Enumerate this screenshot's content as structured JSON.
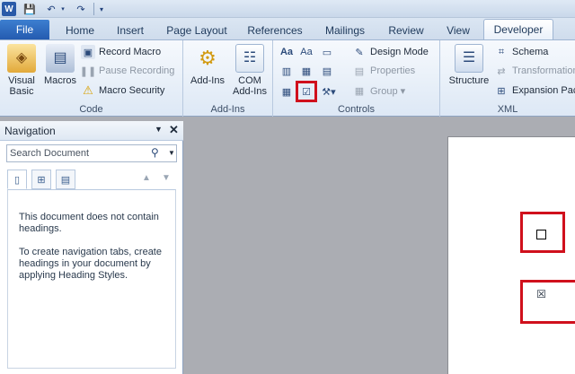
{
  "quick_access": {
    "app_badge": "W",
    "save": "💾",
    "undo": "↶",
    "redo": "↷",
    "dropdown": "▾"
  },
  "tabs": [
    "File",
    "Home",
    "Insert",
    "Page Layout",
    "References",
    "Mailings",
    "Review",
    "View",
    "Developer"
  ],
  "ribbon": {
    "code": {
      "label": "Code",
      "visual_basic": [
        "Visual",
        "Basic"
      ],
      "macros": "Macros",
      "record_macro": "Record Macro",
      "pause_recording": "Pause Recording",
      "macro_security": "Macro Security"
    },
    "addins": {
      "label": "Add-Ins",
      "add_ins": "Add-Ins",
      "com_add_ins": [
        "COM",
        "Add-Ins"
      ]
    },
    "controls": {
      "label": "Controls",
      "rich_text": "Aa",
      "plain_text": "Aa",
      "design_mode": "Design Mode",
      "properties": "Properties",
      "group": "Group ▾"
    },
    "xml": {
      "label": "XML",
      "structure": "Structure",
      "schema": "Schema",
      "transformation": "Transformation",
      "expansion_packs": "Expansion Pac"
    }
  },
  "navigation": {
    "title": "Navigation",
    "search_placeholder": "Search Document",
    "message1": "This document does not contain headings.",
    "message2": "To create navigation tabs, create headings in your document by applying Heading Styles."
  },
  "document": {
    "checkbox_unchecked": "",
    "checkbox_checked": "☒"
  },
  "colors": {
    "highlight": "#d0101c",
    "file_tab": "#2f6cc0"
  }
}
